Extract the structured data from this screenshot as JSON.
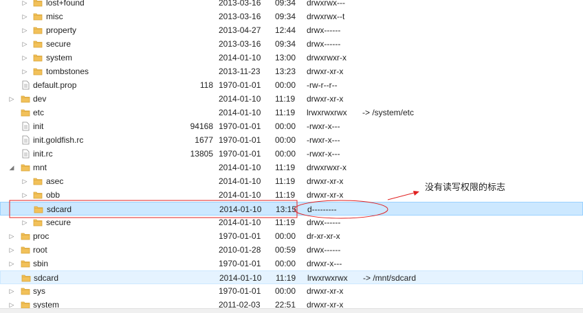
{
  "tree": {
    "rows": [
      {
        "name": "lost+found",
        "size": "",
        "date": "2013-03-16",
        "time": "09:34",
        "perm": "drwxrwx---",
        "link": "",
        "depth": 1,
        "type": "folder",
        "twisty": "collapsed"
      },
      {
        "name": "misc",
        "size": "",
        "date": "2013-03-16",
        "time": "09:34",
        "perm": "drwxrwx--t",
        "link": "",
        "depth": 1,
        "type": "folder",
        "twisty": "collapsed"
      },
      {
        "name": "property",
        "size": "",
        "date": "2013-04-27",
        "time": "12:44",
        "perm": "drwx------",
        "link": "",
        "depth": 1,
        "type": "folder",
        "twisty": "collapsed"
      },
      {
        "name": "secure",
        "size": "",
        "date": "2013-03-16",
        "time": "09:34",
        "perm": "drwx------",
        "link": "",
        "depth": 1,
        "type": "folder",
        "twisty": "collapsed"
      },
      {
        "name": "system",
        "size": "",
        "date": "2014-01-10",
        "time": "13:00",
        "perm": "drwxrwxr-x",
        "link": "",
        "depth": 1,
        "type": "folder",
        "twisty": "collapsed"
      },
      {
        "name": "tombstones",
        "size": "",
        "date": "2013-11-23",
        "time": "13:23",
        "perm": "drwxr-xr-x",
        "link": "",
        "depth": 1,
        "type": "folder",
        "twisty": "collapsed"
      },
      {
        "name": "default.prop",
        "size": "118",
        "date": "1970-01-01",
        "time": "00:00",
        "perm": "-rw-r--r--",
        "link": "",
        "depth": 0,
        "type": "file",
        "twisty": ""
      },
      {
        "name": "dev",
        "size": "",
        "date": "2014-01-10",
        "time": "11:19",
        "perm": "drwxr-xr-x",
        "link": "",
        "depth": 0,
        "type": "folder",
        "twisty": "collapsed"
      },
      {
        "name": "etc",
        "size": "",
        "date": "2014-01-10",
        "time": "11:19",
        "perm": "lrwxrwxrwx",
        "link": "-> /system/etc",
        "depth": 0,
        "type": "folder",
        "twisty": ""
      },
      {
        "name": "init",
        "size": "94168",
        "date": "1970-01-01",
        "time": "00:00",
        "perm": "-rwxr-x---",
        "link": "",
        "depth": 0,
        "type": "file",
        "twisty": ""
      },
      {
        "name": "init.goldfish.rc",
        "size": "1677",
        "date": "1970-01-01",
        "time": "00:00",
        "perm": "-rwxr-x---",
        "link": "",
        "depth": 0,
        "type": "file",
        "twisty": ""
      },
      {
        "name": "init.rc",
        "size": "13805",
        "date": "1970-01-01",
        "time": "00:00",
        "perm": "-rwxr-x---",
        "link": "",
        "depth": 0,
        "type": "file",
        "twisty": ""
      },
      {
        "name": "mnt",
        "size": "",
        "date": "2014-01-10",
        "time": "11:19",
        "perm": "drwxrwxr-x",
        "link": "",
        "depth": 0,
        "type": "folder",
        "twisty": "expanded"
      },
      {
        "name": "asec",
        "size": "",
        "date": "2014-01-10",
        "time": "11:19",
        "perm": "drwxr-xr-x",
        "link": "",
        "depth": 1,
        "type": "folder",
        "twisty": "collapsed"
      },
      {
        "name": "obb",
        "size": "",
        "date": "2014-01-10",
        "time": "11:19",
        "perm": "drwxr-xr-x",
        "link": "",
        "depth": 1,
        "type": "folder",
        "twisty": "collapsed"
      },
      {
        "name": "sdcard",
        "size": "",
        "date": "2014-01-10",
        "time": "13:15",
        "perm": "d---------",
        "link": "",
        "depth": 1,
        "type": "folder",
        "twisty": "",
        "state": "selected"
      },
      {
        "name": "secure",
        "size": "",
        "date": "2014-01-10",
        "time": "11:19",
        "perm": "drwx------",
        "link": "",
        "depth": 1,
        "type": "folder",
        "twisty": "collapsed"
      },
      {
        "name": "proc",
        "size": "",
        "date": "1970-01-01",
        "time": "00:00",
        "perm": "dr-xr-xr-x",
        "link": "",
        "depth": 0,
        "type": "folder",
        "twisty": "collapsed"
      },
      {
        "name": "root",
        "size": "",
        "date": "2010-01-28",
        "time": "00:59",
        "perm": "drwx------",
        "link": "",
        "depth": 0,
        "type": "folder",
        "twisty": "collapsed"
      },
      {
        "name": "sbin",
        "size": "",
        "date": "1970-01-01",
        "time": "00:00",
        "perm": "drwxr-x---",
        "link": "",
        "depth": 0,
        "type": "folder",
        "twisty": "collapsed"
      },
      {
        "name": "sdcard",
        "size": "",
        "date": "2014-01-10",
        "time": "11:19",
        "perm": "lrwxrwxrwx",
        "link": "-> /mnt/sdcard",
        "depth": 0,
        "type": "folder",
        "twisty": "",
        "state": "hovered"
      },
      {
        "name": "sys",
        "size": "",
        "date": "1970-01-01",
        "time": "00:00",
        "perm": "drwxr-xr-x",
        "link": "",
        "depth": 0,
        "type": "folder",
        "twisty": "collapsed"
      },
      {
        "name": "system",
        "size": "",
        "date": "2011-02-03",
        "time": "22:51",
        "perm": "drwxr-xr-x",
        "link": "",
        "depth": 0,
        "type": "folder",
        "twisty": "collapsed"
      }
    ]
  },
  "annotation": {
    "text": "没有读写权限的标志",
    "color": "#e02020"
  },
  "colors": {
    "folder": "#f2c15a",
    "folder_dark": "#d9a436",
    "selected_bg": "#cce8ff",
    "hover_bg": "#e5f3ff"
  }
}
